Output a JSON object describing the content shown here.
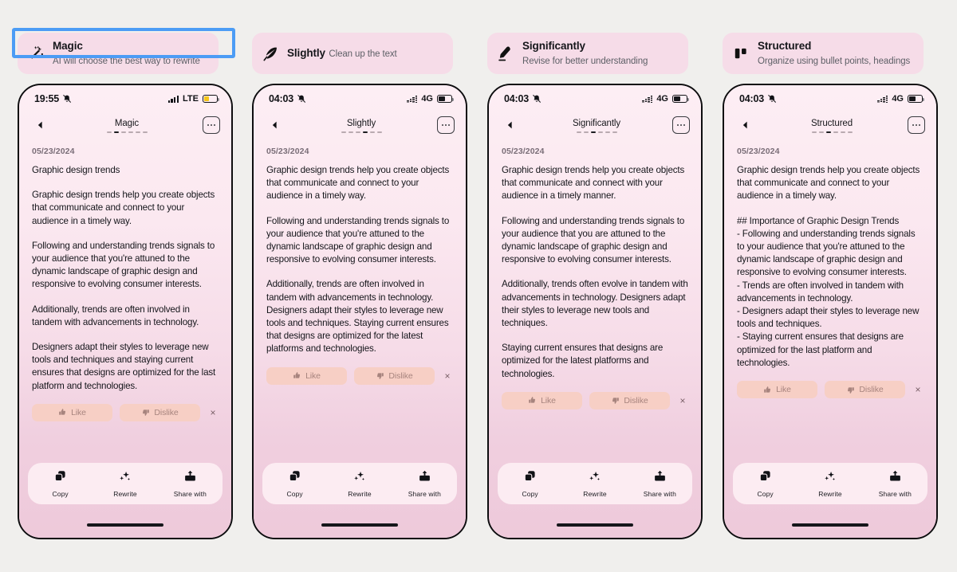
{
  "canvas": {
    "background": "#f0efed",
    "accent": "#4c9cf5",
    "card_bg": "#f6dce8"
  },
  "columns": [
    {
      "option": {
        "icon": "magic-wand-icon",
        "title": "Magic",
        "subtitle": "AI will choose the best way to rewrite"
      },
      "selected": true,
      "phone": {
        "status": {
          "time": "19:55",
          "mute_icon": "bell-muted-icon",
          "signal_icon": "signal-bars-icon",
          "network": "LTE",
          "battery_icon": "battery-icon",
          "battery_color": "#f5c518",
          "battery_level": 42
        },
        "nav": {
          "back_icon": "back-triangle-icon",
          "title": "Magic",
          "dashes": [
            0,
            1,
            0,
            0,
            0,
            0
          ],
          "more_icon": "more-options-icon"
        },
        "date": "05/23/2024",
        "paragraphs": [
          "Graphic design trends",
          "Graphic design trends help you create objects that communicate and connect to your audience in a timely way.",
          "Following and understanding trends signals to your audience that you're attuned to the dynamic landscape of graphic design and responsive to evolving consumer interests.",
          "Additionally, trends are often involved in tandem with advancements in technology.",
          "Designers adapt their styles to leverage new tools and techniques and staying current ensures that designs are optimized for the last platform and technologies."
        ],
        "feedback": {
          "like_label": "Like",
          "like_icon": "thumbs-up-icon",
          "dislike_label": "Dislike",
          "dislike_icon": "thumbs-down-icon",
          "close_icon": "close-icon",
          "close_glyph": "×"
        },
        "toolbar": [
          {
            "icon": "copy-icon",
            "label": "Copy"
          },
          {
            "icon": "sparkles-icon",
            "label": "Rewrite"
          },
          {
            "icon": "share-icon",
            "label": "Share with"
          }
        ]
      }
    },
    {
      "option": {
        "icon": "feather-quill-icon",
        "title": "Slightly",
        "subtitle": "Clean up the text"
      },
      "selected": false,
      "phone": {
        "status": {
          "time": "04:03",
          "mute_icon": "bell-muted-icon",
          "signal_icon": "signal-bars-icon",
          "network": "4G",
          "battery_icon": "battery-icon",
          "battery_color": "#15161a",
          "battery_level": 55
        },
        "nav": {
          "back_icon": "back-triangle-icon",
          "title": "Slightly",
          "dashes": [
            0,
            0,
            0,
            1,
            0,
            0
          ],
          "more_icon": "more-options-icon"
        },
        "date": "05/23/2024",
        "paragraphs": [
          "Graphic design trends help you create objects that communicate and connect to your audience in a timely way.",
          "Following and understanding trends signals to your audience that you're attuned to the dynamic landscape of graphic design and responsive to evolving consumer interests.",
          "Additionally, trends are often involved in tandem with advancements in technology. Designers adapt their styles to leverage new tools and techniques. Staying current ensures that designs are optimized for the latest platforms and technologies."
        ],
        "feedback": {
          "like_label": "Like",
          "like_icon": "thumbs-up-icon",
          "dislike_label": "Dislike",
          "dislike_icon": "thumbs-down-icon",
          "close_icon": "close-icon",
          "close_glyph": "×"
        },
        "toolbar": [
          {
            "icon": "copy-icon",
            "label": "Copy"
          },
          {
            "icon": "sparkles-icon",
            "label": "Rewrite"
          },
          {
            "icon": "share-icon",
            "label": "Share with"
          }
        ]
      }
    },
    {
      "option": {
        "icon": "pen-underline-icon",
        "title": "Significantly",
        "subtitle": "Revise for better understanding"
      },
      "selected": false,
      "phone": {
        "status": {
          "time": "04:03",
          "mute_icon": "bell-muted-icon",
          "signal_icon": "signal-bars-icon",
          "network": "4G",
          "battery_icon": "battery-icon",
          "battery_color": "#15161a",
          "battery_level": 55
        },
        "nav": {
          "back_icon": "back-triangle-icon",
          "title": "Significantly",
          "dashes": [
            0,
            0,
            1,
            0,
            0,
            0
          ],
          "more_icon": "more-options-icon"
        },
        "date": "05/23/2024",
        "paragraphs": [
          "Graphic design trends help you create objects that communicate and connect with your audience in a timely manner.",
          "Following and understanding trends signals to your audience that you are attuned to the dynamic landscape of graphic design and responsive to evolving consumer interests.",
          "Additionally, trends often evolve in tandem with advancements in technology. Designers adapt their styles to leverage new tools and techniques.",
          "Staying current ensures that designs are optimized for the latest platforms and technologies."
        ],
        "feedback": {
          "like_label": "Like",
          "like_icon": "thumbs-up-icon",
          "dislike_label": "Dislike",
          "dislike_icon": "thumbs-down-icon",
          "close_icon": "close-icon",
          "close_glyph": "×"
        },
        "toolbar": [
          {
            "icon": "copy-icon",
            "label": "Copy"
          },
          {
            "icon": "sparkles-icon",
            "label": "Rewrite"
          },
          {
            "icon": "share-icon",
            "label": "Share with"
          }
        ]
      }
    },
    {
      "option": {
        "icon": "bullet-blocks-icon",
        "title": "Structured",
        "subtitle": "Organize using bullet points, headings"
      },
      "selected": false,
      "phone": {
        "status": {
          "time": "04:03",
          "mute_icon": "bell-muted-icon",
          "signal_icon": "signal-bars-icon",
          "network": "4G",
          "battery_icon": "battery-icon",
          "battery_color": "#15161a",
          "battery_level": 55
        },
        "nav": {
          "back_icon": "back-triangle-icon",
          "title": "Structured",
          "dashes": [
            0,
            0,
            1,
            0,
            0,
            0
          ],
          "more_icon": "more-options-icon"
        },
        "date": "05/23/2024",
        "paragraphs": [
          "Graphic design trends help you create objects that communicate and connect to your audience in a timely way.",
          "## Importance of Graphic Design Trends\n- Following and understanding trends signals to your audience that you're attuned to the dynamic landscape of graphic design and responsive to evolving consumer interests.\n- Trends are often involved in tandem with advancements in technology.\n- Designers adapt their styles to leverage new tools and techniques.\n- Staying current ensures that designs are optimized for the last platform and technologies."
        ],
        "feedback": {
          "like_label": "Like",
          "like_icon": "thumbs-up-icon",
          "dislike_label": "Dislike",
          "dislike_icon": "thumbs-down-icon",
          "close_icon": "close-icon",
          "close_glyph": "×"
        },
        "toolbar": [
          {
            "icon": "copy-icon",
            "label": "Copy"
          },
          {
            "icon": "sparkles-icon",
            "label": "Rewrite"
          },
          {
            "icon": "share-icon",
            "label": "Share with"
          }
        ]
      }
    }
  ]
}
